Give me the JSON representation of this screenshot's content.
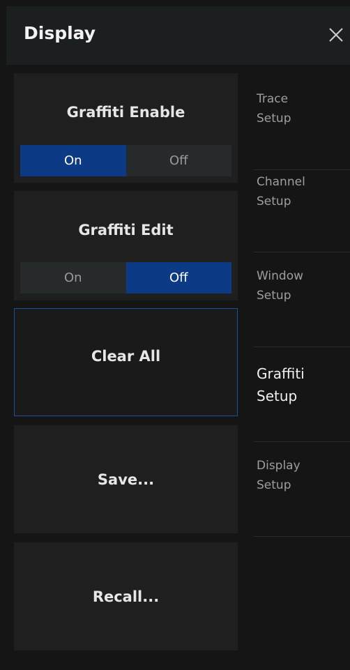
{
  "header": {
    "title": "Display",
    "close_icon": "close-icon"
  },
  "graffiti_enable": {
    "label": "Graffiti Enable",
    "on": "On",
    "off": "Off",
    "selected": "On"
  },
  "graffiti_edit": {
    "label": "Graffiti Edit",
    "on": "On",
    "off": "Off",
    "selected": "Off"
  },
  "actions": {
    "clear_all": "Clear All",
    "save": "Save...",
    "recall": "Recall..."
  },
  "nav": {
    "items": [
      {
        "label": "Trace\nSetup"
      },
      {
        "label": "Channel\nSetup"
      },
      {
        "label": "Window\nSetup"
      },
      {
        "label": "Graffiti\nSetup"
      },
      {
        "label": "Display\nSetup"
      }
    ],
    "active_index": 3
  },
  "colors": {
    "accent": "#0d3a84",
    "focus_border": "#1c4f9c"
  }
}
